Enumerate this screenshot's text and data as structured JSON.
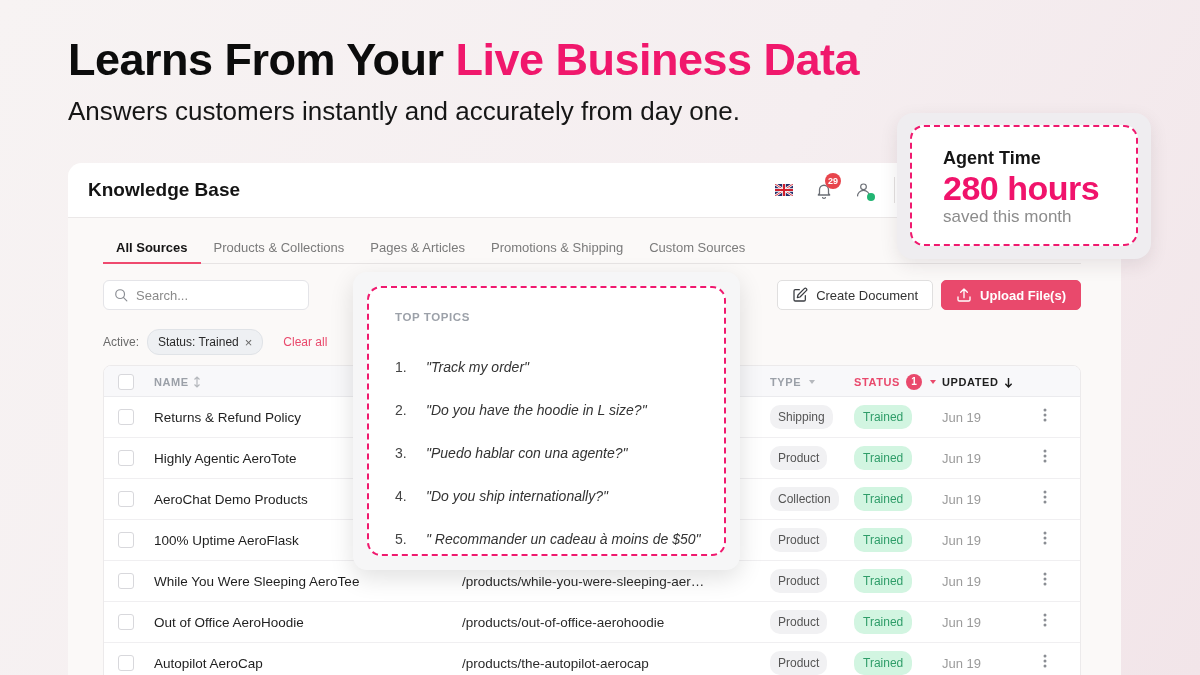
{
  "headline": {
    "text": "Learns From Your",
    "highlight": "Live Business Data"
  },
  "subtitle": "Answers customers instantly and accurately from day one.",
  "agent_time_card": {
    "title": "Agent Time",
    "value": "280 hours",
    "caption": "saved this month"
  },
  "knowledge_base": {
    "title": "Knowledge Base",
    "notification_count": "29",
    "user_online": true,
    "tabs": [
      {
        "label": "All Sources",
        "selected": true
      },
      {
        "label": "Products & Collections",
        "selected": false
      },
      {
        "label": "Pages & Articles",
        "selected": false
      },
      {
        "label": "Promotions & Shipping",
        "selected": false
      },
      {
        "label": "Custom Sources",
        "selected": false
      }
    ],
    "search": {
      "placeholder": "Search..."
    },
    "buttons": [
      {
        "label": "Create Document",
        "kind": "create"
      },
      {
        "label": "Upload File(s)",
        "kind": "upload"
      }
    ],
    "active_filters": {
      "label": "Active:",
      "chips": [
        {
          "label": "Status: Trained",
          "remove": "×"
        }
      ],
      "clear": "Clear all"
    },
    "table": {
      "select_all_checked": false,
      "columns": [
        {
          "label": "NAME",
          "kind": "sortable"
        },
        {
          "label": "TYPE",
          "kind": "filter",
          "filtered": false
        },
        {
          "label": "STATUS",
          "kind": "filter",
          "filtered": true,
          "filter_count": "1"
        },
        {
          "label": "UPDATED",
          "kind": "sorted",
          "descending": true
        }
      ],
      "rows": [
        {
          "name": "Returns & Refund Policy",
          "type": "Shipping",
          "status": "Trained",
          "updated": "Jun 19",
          "checked": false
        },
        {
          "name": "Highly Agentic AeroTote",
          "type": "Product",
          "status": "Trained",
          "updated": "Jun 19",
          "checked": false
        },
        {
          "name": "AeroChat Demo Products",
          "type": "Collection",
          "status": "Trained",
          "updated": "Jun 19",
          "checked": false
        },
        {
          "name": "100% Uptime AeroFlask",
          "type": "Product",
          "status": "Trained",
          "updated": "Jun 19",
          "checked": false
        },
        {
          "name": "While You Were Sleeping AeroTee",
          "url": "/products/while-you-were-sleeping-aer…",
          "type": "Product",
          "status": "Trained",
          "updated": "Jun 19",
          "checked": false
        },
        {
          "name": "Out of Office AeroHoodie",
          "url": "/products/out-of-office-aerohoodie",
          "type": "Product",
          "status": "Trained",
          "updated": "Jun 19",
          "checked": false
        },
        {
          "name": "Autopilot AeroCap",
          "url": "/products/the-autopilot-aerocap",
          "type": "Product",
          "status": "Trained",
          "updated": "Jun 19",
          "checked": false
        }
      ]
    }
  },
  "top_topics": {
    "title": "TOP TOPICS",
    "items": [
      {
        "number": "1.",
        "text": "\"Track my order\""
      },
      {
        "number": "2.",
        "text": "\"Do you have the hoodie in L size?\""
      },
      {
        "number": "3.",
        "text": "\"Puedo hablar con una agente?\""
      },
      {
        "number": "4.",
        "text": "\"Do you ship internationally?\""
      },
      {
        "number": "5.",
        "text": "\" Recommander un cadeau à moins de $50\""
      }
    ]
  }
}
